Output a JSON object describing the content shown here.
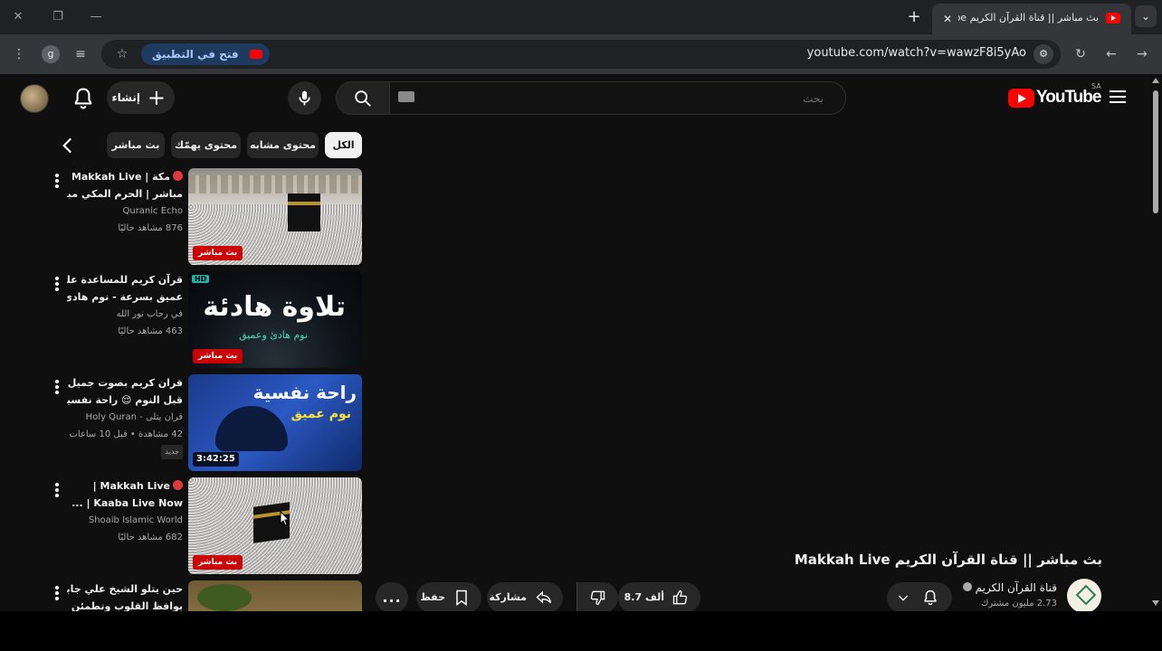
{
  "browser": {
    "tab_title": "بث مباشر || قناة القرآن الكريم Makkah Live - YouTube",
    "profile_initial": "g",
    "open_in_app_label": "فتح في التطبيق",
    "url": "youtube.com/watch?v=wawzF8i5yAo"
  },
  "youtube": {
    "logo_text": "YouTube",
    "country_code": "SA",
    "search_placeholder": "بحث",
    "create_label": "إنشاء"
  },
  "chips": [
    {
      "label": "الكل",
      "active": true
    },
    {
      "label": "محتوى مشابه",
      "active": false
    },
    {
      "label": "محتوى يهمّك",
      "active": false
    },
    {
      "label": "بث مباشر",
      "active": false
    }
  ],
  "videos": [
    {
      "title_line1": "مكة | Makkah Live",
      "title_line2": "مباشر | الحرم المكي مباشر...",
      "channel": "Quranic Echo",
      "views": "876 مشاهد حاليًا",
      "badge": "بث مباشر",
      "badge_type": "live",
      "live_dot": true
    },
    {
      "title_line1": "قرآن كريم للمساعدة على نوم",
      "title_line2": "عميق بسرعة - نوم هادئ ...",
      "channel": "في رحاب نور الله",
      "views": "463 مشاهد حاليًا",
      "badge": "بث مباشر",
      "badge_type": "live",
      "thumb_title": "تلاوة هادئة",
      "thumb_sub": "نوم هادئ وعميق",
      "thumb_hd": "HD"
    },
    {
      "title_line1": "قران كريم بصوت جميل جدا",
      "title_line2": "قبل النوم 😌 راحة نفسية ...",
      "channel": "قران يتلى - Holy Quran",
      "views": "42 مشاهدة • قبل 10 ساعات",
      "new_label": "جديد",
      "badge": "3:42:25",
      "badge_type": "duration",
      "thumb_title": "راحة نفسية",
      "thumb_sub": "نوم عميق"
    },
    {
      "title_line1": "Makkah Live |",
      "title_line2": "Kaaba Live Now | ...",
      "channel": "Shoaib Islamic World",
      "views": "682 مشاهد حاليًا",
      "badge": "بث مباشر",
      "badge_type": "live",
      "live_dot": true
    },
    {
      "title_line1": "حين يتلو الشيخ علي جابر",
      "title_line2": "بوافظ القلوب وتطمئن"
    }
  ],
  "watch": {
    "title": "بث مباشر || قناة القرآن الكريم Makkah Live",
    "channel_name": "قناة القرآن الكريم",
    "subscribers": "2.73 مليون مشترك",
    "likes": "8.7 ألف",
    "share_label": "مشاركة",
    "save_label": "حفظ",
    "more_label": "..."
  },
  "colors": {
    "youtube_red": "#ff0000",
    "live_badge": "#cc0000",
    "page_bg": "#0f0f0f",
    "chip_bg": "#272727"
  }
}
